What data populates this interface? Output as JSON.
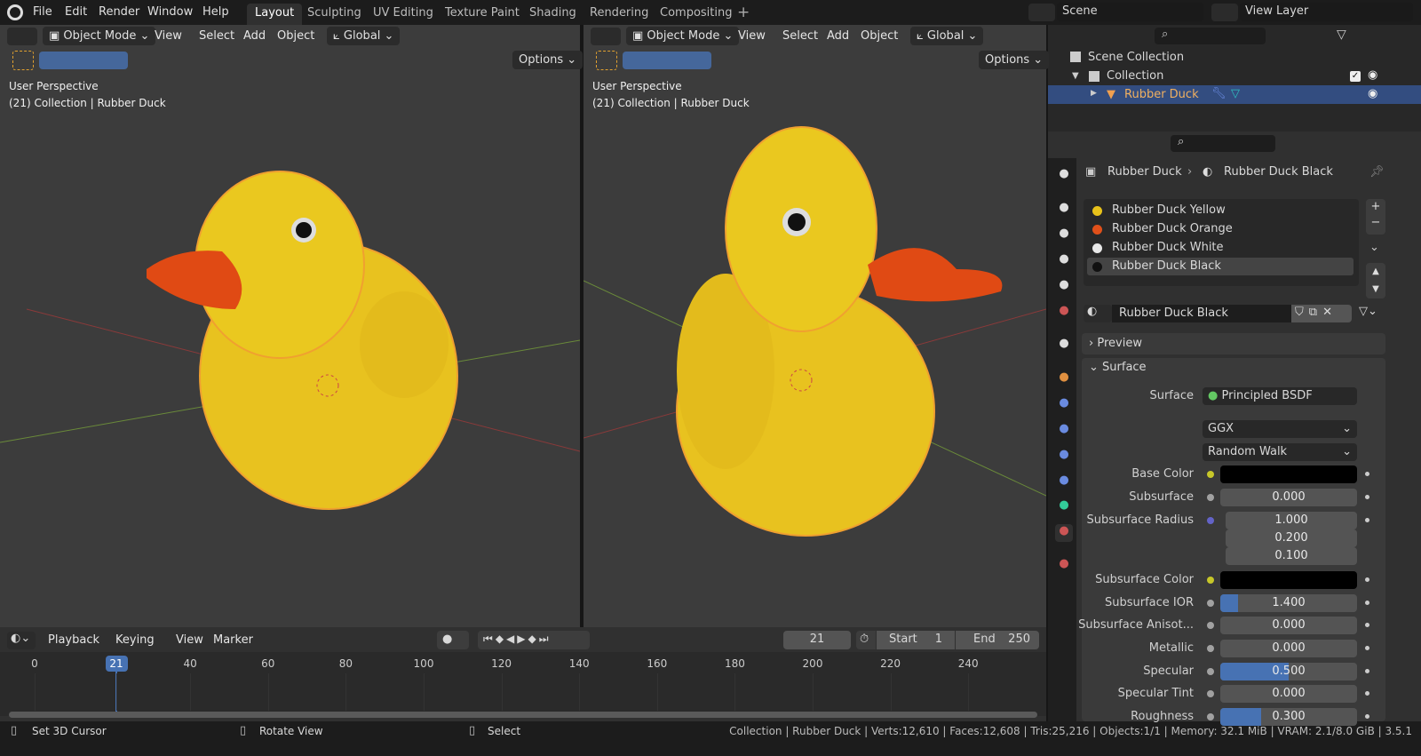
{
  "topbar": {
    "menus": [
      "File",
      "Edit",
      "Render",
      "Window",
      "Help"
    ],
    "workspaces": [
      "Layout",
      "Sculpting",
      "UV Editing",
      "Texture Paint",
      "Shading",
      "Rendering",
      "Compositing"
    ],
    "active_workspace": "Layout",
    "scene": "Scene",
    "view_layer": "View Layer"
  },
  "viewport_header": {
    "mode": "Object Mode",
    "menus": [
      "View",
      "Select",
      "Add",
      "Object"
    ],
    "orientation": "Global",
    "options": "Options"
  },
  "viewports": [
    {
      "title": "User Perspective",
      "subtitle": "(21) Collection | Rubber Duck"
    },
    {
      "title": "User Perspective",
      "subtitle": "(21) Collection | Rubber Duck"
    }
  ],
  "outliner": {
    "scene_collection": "Scene Collection",
    "collection": "Collection",
    "object": "Rubber Duck"
  },
  "properties": {
    "breadcrumb_object": "Rubber Duck",
    "breadcrumb_material": "Rubber Duck Black",
    "material_slots": [
      {
        "name": "Rubber Duck Yellow",
        "color": "#e8c21a"
      },
      {
        "name": "Rubber Duck Orange",
        "color": "#e0501a"
      },
      {
        "name": "Rubber Duck White",
        "color": "#e8e8e8"
      },
      {
        "name": "Rubber Duck Black",
        "color": "#111111"
      }
    ],
    "material_name": "Rubber Duck Black",
    "preview": "Preview",
    "surface_panel": "Surface",
    "surface_label": "Surface",
    "surface_shader": "Principled BSDF",
    "distribution": "GGX",
    "subsurface_method": "Random Walk",
    "rows": [
      {
        "label": "Base Color",
        "type": "color",
        "color": "#000000",
        "socket": "#c7c729"
      },
      {
        "label": "Subsurface",
        "value": "0.000",
        "fraction": 0,
        "socket": "#a1a1a1"
      },
      {
        "label": "Subsurface Radius",
        "value": "1.000",
        "socket": "#6363c7"
      },
      {
        "label": "",
        "value": "0.200"
      },
      {
        "label": "",
        "value": "0.100"
      },
      {
        "label": "Subsurface Color",
        "type": "color",
        "color": "#000000",
        "socket": "#c7c729"
      },
      {
        "label": "Subsurface IOR",
        "value": "1.400",
        "fraction": 0.13,
        "socket": "#a1a1a1"
      },
      {
        "label": "Subsurface Anisot...",
        "value": "0.000",
        "fraction": 0,
        "socket": "#a1a1a1"
      },
      {
        "label": "Metallic",
        "value": "0.000",
        "fraction": 0,
        "socket": "#a1a1a1"
      },
      {
        "label": "Specular",
        "value": "0.500",
        "fraction": 0.5,
        "socket": "#a1a1a1"
      },
      {
        "label": "Specular Tint",
        "value": "0.000",
        "fraction": 0,
        "socket": "#a1a1a1"
      },
      {
        "label": "Roughness",
        "value": "0.300",
        "fraction": 0.3,
        "socket": "#a1a1a1"
      }
    ]
  },
  "timeline": {
    "menus": [
      "Playback",
      "Keying",
      "View",
      "Marker"
    ],
    "current_frame": "21",
    "start_label": "Start",
    "start": "1",
    "end_label": "End",
    "end": "250",
    "ticks": [
      "0",
      "21",
      "40",
      "60",
      "80",
      "100",
      "120",
      "140",
      "160",
      "180",
      "200",
      "220",
      "240"
    ]
  },
  "statusbar": {
    "left": [
      "Set 3D Cursor",
      "Rotate View",
      "Select"
    ],
    "stats": "Collection | Rubber Duck | Verts:12,610 | Faces:12,608 | Tris:25,216 | Objects:1/1 | Memory: 32.1 MiB | VRAM: 2.1/8.0 GiB | 3.5.1"
  }
}
